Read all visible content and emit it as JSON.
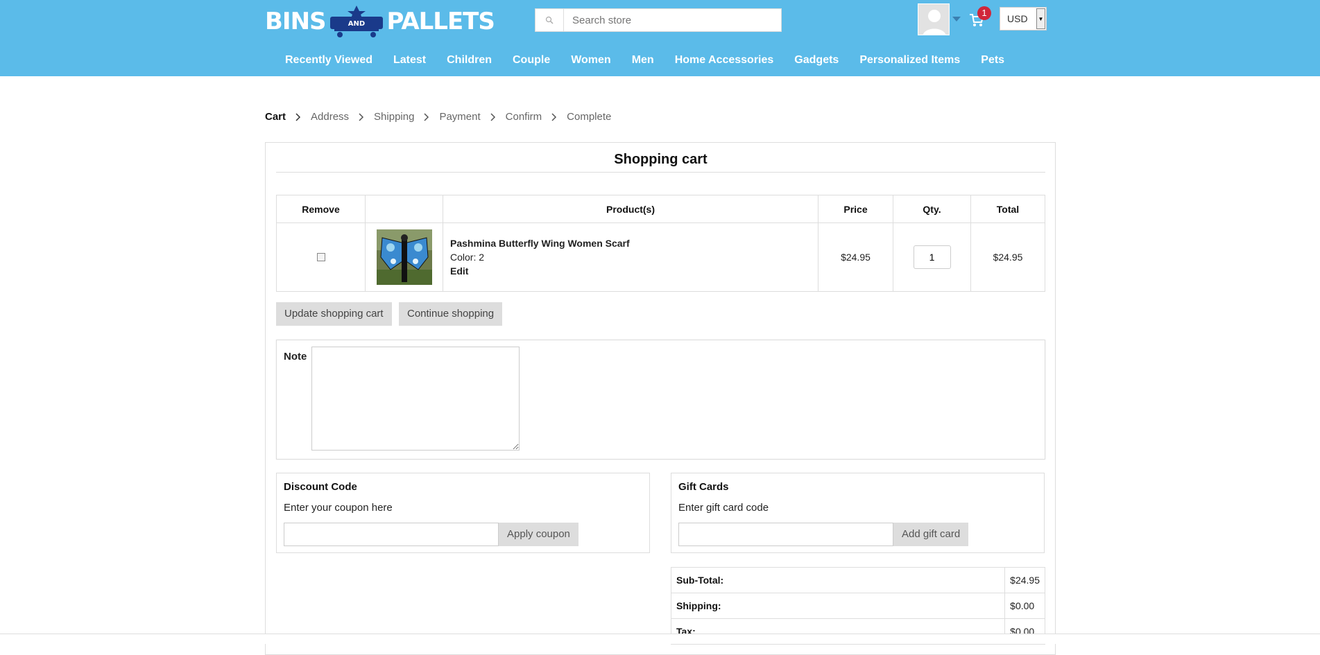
{
  "header": {
    "logo": {
      "left": "BINS",
      "mark": "AND",
      "right": "PALLETS"
    },
    "search_placeholder": "Search store",
    "cart_count": "1",
    "currency": "USD",
    "colors": {
      "header_bg": "#5bbbe9",
      "badge": "#d0263a"
    }
  },
  "nav": [
    "Recently Viewed",
    "Latest",
    "Children",
    "Couple",
    "Women",
    "Men",
    "Home Accessories",
    "Gadgets",
    "Personalized Items",
    "Pets"
  ],
  "breadcrumb": [
    "Cart",
    "Address",
    "Shipping",
    "Payment",
    "Confirm",
    "Complete"
  ],
  "cart": {
    "title": "Shopping cart",
    "columns": [
      "Remove",
      "",
      "Product(s)",
      "Price",
      "Qty.",
      "Total"
    ],
    "items": [
      {
        "name": "Pashmina Butterfly Wing Women Scarf",
        "attribute": "Color: 2",
        "edit": "Edit",
        "price": "$24.95",
        "qty": "1",
        "total": "$24.95"
      }
    ],
    "update_button": "Update shopping cart",
    "continue_button": "Continue shopping",
    "note_label": "Note"
  },
  "discount": {
    "title": "Discount Code",
    "hint": "Enter your coupon here",
    "button": "Apply coupon"
  },
  "giftcard": {
    "title": "Gift Cards",
    "hint": "Enter gift card code",
    "button": "Add gift card"
  },
  "totals": [
    {
      "label": "Sub-Total:",
      "value": "$24.95"
    },
    {
      "label": "Shipping:",
      "value": "$0.00"
    },
    {
      "label": "Tax:",
      "value": "$0.00"
    }
  ]
}
